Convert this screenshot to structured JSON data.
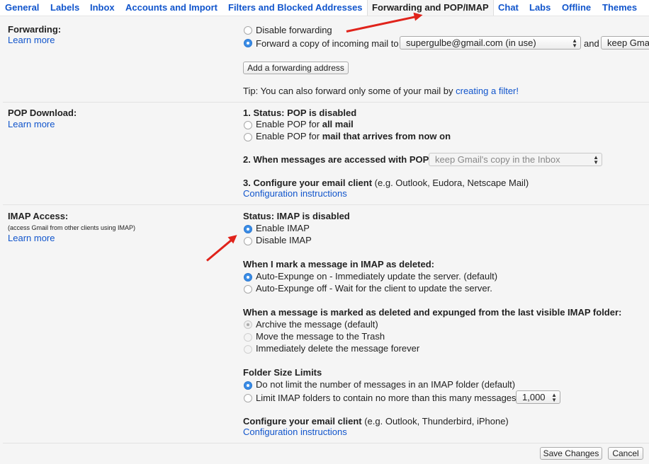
{
  "tabs": {
    "general": "General",
    "labels": "Labels",
    "inbox": "Inbox",
    "accounts": "Accounts and Import",
    "filters": "Filters and Blocked Addresses",
    "forwarding": "Forwarding and POP/IMAP",
    "chat": "Chat",
    "labs": "Labs",
    "offline": "Offline",
    "themes": "Themes"
  },
  "forwarding": {
    "title": "Forwarding:",
    "learn_more": "Learn more",
    "disable_label": "Disable forwarding",
    "forward_label": "Forward a copy of incoming mail to",
    "forward_address": "supergulbe@gmail.com (in use)",
    "and_label": "and",
    "keep_option": "keep Gmail's copy in the Inbox",
    "add_button": "Add a forwarding address",
    "tip_prefix": "Tip: You can also forward only some of your mail by",
    "tip_link": "creating a filter!"
  },
  "pop": {
    "title": "POP Download:",
    "learn_more": "Learn more",
    "status_prefix": "1. Status: ",
    "status_value": "POP is disabled",
    "enable_all_prefix": "Enable POP for ",
    "enable_all_bold": "all mail",
    "enable_now_prefix": "Enable POP for ",
    "enable_now_bold": "mail that arrives from now on",
    "accessed_label": "2. When messages are accessed with POP",
    "accessed_option": "keep Gmail's copy in the Inbox",
    "configure_label": "3. Configure your email client",
    "configure_examples": "(e.g. Outlook, Eudora, Netscape Mail)",
    "config_link": "Configuration instructions"
  },
  "imap": {
    "title": "IMAP Access:",
    "subtitle": "(access Gmail from other clients using IMAP)",
    "learn_more": "Learn more",
    "status_label": "Status: IMAP is disabled",
    "enable_label": "Enable IMAP",
    "disable_label": "Disable IMAP",
    "deleted_heading": "When I mark a message in IMAP as deleted:",
    "expunge_on": "Auto-Expunge on - Immediately update the server. (default)",
    "expunge_off": "Auto-Expunge off - Wait for the client to update the server.",
    "expunged_heading": "When a message is marked as deleted and expunged from the last visible IMAP folder:",
    "archive": "Archive the message (default)",
    "trash": "Move the message to the Trash",
    "delete_forever": "Immediately delete the message forever",
    "folder_heading": "Folder Size Limits",
    "no_limit": "Do not limit the number of messages in an IMAP folder (default)",
    "limit_label": "Limit IMAP folders to contain no more than this many messages",
    "limit_value": "1,000",
    "configure_label": "Configure your email client",
    "configure_examples": "(e.g. Outlook, Thunderbird, iPhone)",
    "config_link": "Configuration instructions"
  },
  "footer": {
    "save": "Save Changes",
    "cancel": "Cancel"
  },
  "colors": {
    "link": "#1155cc",
    "radio_selected": "#3b8de6",
    "annotation_arrow": "#e0231b"
  }
}
